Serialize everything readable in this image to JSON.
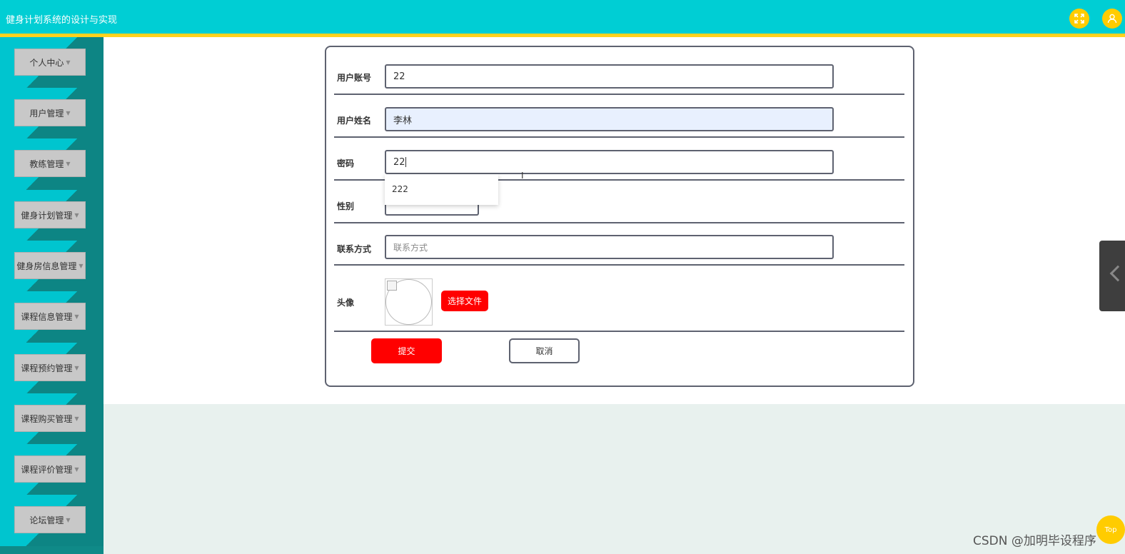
{
  "header": {
    "title": "健身计划系统的设计与实现",
    "accent": "#00ced4",
    "line_color": "#ffd21e",
    "icons": [
      "fullscreen-icon",
      "user-icon"
    ]
  },
  "sidebar": {
    "items": [
      {
        "label": "个人中心"
      },
      {
        "label": "用户管理"
      },
      {
        "label": "教练管理"
      },
      {
        "label": "健身计划管理"
      },
      {
        "label": "健身房信息管理"
      },
      {
        "label": "课程信息管理"
      },
      {
        "label": "课程预约管理"
      },
      {
        "label": "课程购买管理"
      },
      {
        "label": "课程评价管理"
      },
      {
        "label": "论坛管理"
      }
    ]
  },
  "form": {
    "account_label": "用户账号",
    "account_value": "22",
    "name_label": "用户姓名",
    "name_value": "李林",
    "password_label": "密码",
    "password_value": "22",
    "autocomplete_option": "222",
    "gender_label": "性别",
    "contact_label": "联系方式",
    "contact_placeholder": "联系方式",
    "avatar_label": "头像",
    "file_button": "选择文件",
    "submit_button": "提交",
    "cancel_button": "取消"
  },
  "floating": {
    "top_label": "Top",
    "watermark": "CSDN @加明毕设程序"
  },
  "colors": {
    "primary_button": "#ff0000",
    "sidebar_light": "#00c5cf",
    "sidebar_dark": "#0d8584"
  }
}
